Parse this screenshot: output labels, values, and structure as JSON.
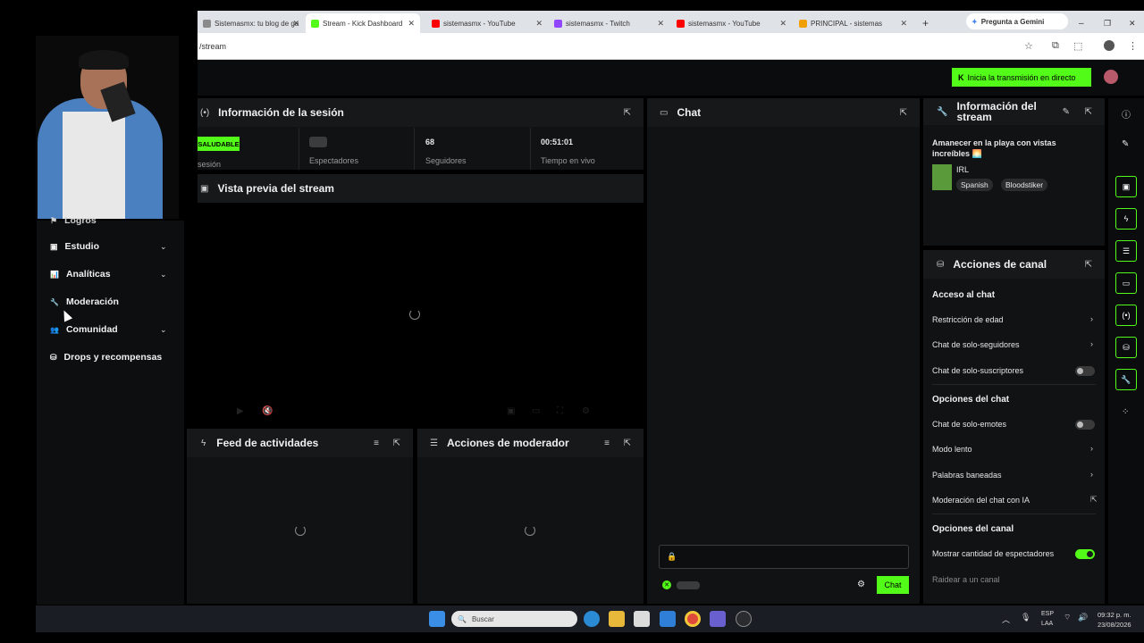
{
  "browser": {
    "tabs": [
      {
        "title": "Sistemasmx: tu blog de ga",
        "color": "#8a8a8a"
      },
      {
        "title": "Stream - Kick Dashboard",
        "color": "#53fc18"
      },
      {
        "title": "sistemasmx - YouTube",
        "color": "#ff0000"
      },
      {
        "title": "sistemasmx - Twitch",
        "color": "#9146ff"
      },
      {
        "title": "sistemasmx - YouTube",
        "color": "#ff0000"
      },
      {
        "title": "PRINCIPAL - sistemas",
        "color": "#f0a000"
      }
    ],
    "new_tab": "+",
    "gemini": "Pregunta a Gemini",
    "url": "/stream"
  },
  "header": {
    "go_live": "Inicia la transmisión en directo"
  },
  "sidebar": {
    "items": [
      {
        "label": "Logros",
        "icon": "trophy-icon",
        "glyph": "⚑"
      },
      {
        "label": "Estudio",
        "icon": "studio-icon",
        "glyph": "▣",
        "expandable": true
      },
      {
        "label": "Analíticas",
        "icon": "chart-icon",
        "glyph": "📊",
        "expandable": true
      },
      {
        "label": "Moderación",
        "icon": "wrench-icon",
        "glyph": "🔧"
      },
      {
        "label": "Comunidad",
        "icon": "community-icon",
        "glyph": "👥",
        "expandable": true
      },
      {
        "label": "Drops y recompensas",
        "icon": "drops-icon",
        "glyph": "⛁"
      }
    ]
  },
  "session": {
    "title": "Información de la sesión",
    "status_badge": "SALUDABLE",
    "stats": [
      {
        "label": "sesión",
        "value": ""
      },
      {
        "label": "Espectadores",
        "value": ""
      },
      {
        "label": "Seguidores",
        "value": "68"
      },
      {
        "label": "Tiempo en vivo",
        "value": "00:51:01"
      }
    ]
  },
  "preview": {
    "title": "Vista previa del stream"
  },
  "feed": {
    "title": "Feed de actividades"
  },
  "modactions": {
    "title": "Acciones de moderador"
  },
  "chat": {
    "title": "Chat",
    "send_label": "Chat"
  },
  "stream_info": {
    "title": "Información del stream",
    "stream_title": "Amanecer en la playa con vistas increíbles 🌅",
    "category": "IRL",
    "tags": [
      "Spanish",
      "Bloodstiker"
    ]
  },
  "channel_actions": {
    "title": "Acciones de canal",
    "sections": [
      {
        "heading": "Acceso al chat",
        "rows": [
          {
            "label": "Restricción de edad",
            "control": "chevron"
          },
          {
            "label": "Chat de solo-seguidores",
            "control": "chevron"
          },
          {
            "label": "Chat de solo-suscriptores",
            "control": "toggle",
            "on": false
          }
        ]
      },
      {
        "heading": "Opciones del chat",
        "rows": [
          {
            "label": "Chat de solo-emotes",
            "control": "toggle",
            "on": false
          },
          {
            "label": "Modo lento",
            "control": "chevron"
          },
          {
            "label": "Palabras baneadas",
            "control": "chevron"
          },
          {
            "label": "Moderación del chat con IA",
            "control": "external"
          }
        ]
      },
      {
        "heading": "Opciones del canal",
        "rows": [
          {
            "label": "Mostrar cantidad de espectadores",
            "control": "toggle",
            "on": true
          },
          {
            "label": "Raidear a un canal",
            "control": "none"
          }
        ]
      }
    ]
  },
  "taskbar": {
    "search": "Buscar",
    "lang_top": "ESP",
    "lang_bottom": "LAA",
    "time": "09:32 p. m.",
    "date": "23/08/2026"
  },
  "colors": {
    "accent": "#53fc18",
    "bg": "#0b0c0d",
    "panel": "#111213"
  }
}
